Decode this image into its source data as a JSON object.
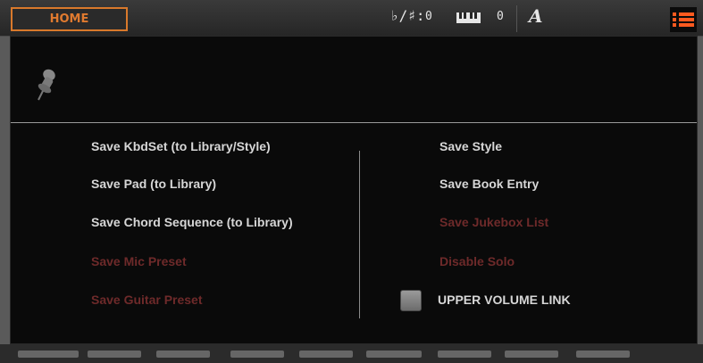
{
  "topbar": {
    "home_label": "HOME",
    "accidental_symbol": "♭/♯:",
    "accidental_value": "0",
    "keyboard_value": "0",
    "mode_letter": "A"
  },
  "dialog": {
    "left_items": [
      {
        "label": "Save KbdSet (to Library/Style)",
        "enabled": true
      },
      {
        "label": "Save Pad (to Library)",
        "enabled": true
      },
      {
        "label": "Save Chord Sequence (to Library)",
        "enabled": true
      },
      {
        "label": "Save Mic Preset",
        "enabled": false
      },
      {
        "label": "Save Guitar Preset",
        "enabled": false
      }
    ],
    "right_items": [
      {
        "label": "Save Style",
        "enabled": true
      },
      {
        "label": "Save Book Entry",
        "enabled": true
      },
      {
        "label": "Save Jukebox List",
        "enabled": false
      },
      {
        "label": "Disable Solo",
        "enabled": false
      }
    ],
    "checkbox": {
      "label": "UPPER VOLUME LINK",
      "checked": false
    }
  },
  "colors": {
    "accent": "#e07a2f",
    "menu_icon": "#ff5a1f",
    "enabled_text": "#d7d7d7",
    "disabled_text": "#6e2a2a"
  }
}
